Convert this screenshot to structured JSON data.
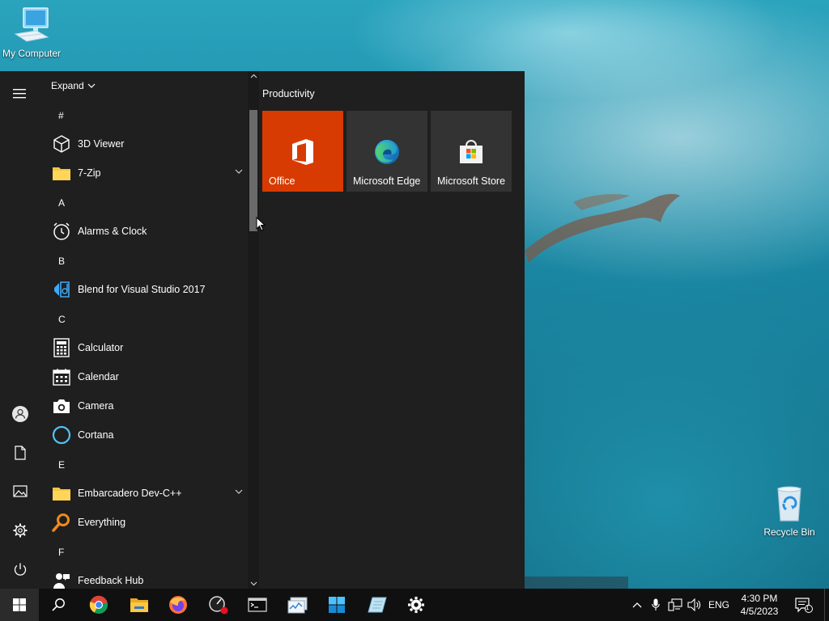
{
  "desktop": {
    "icons": {
      "my_computer": "My Computer",
      "recycle_bin": "Recycle Bin"
    }
  },
  "start_menu": {
    "expand_label": "Expand",
    "headers": {
      "hash": "#",
      "a": "A",
      "b": "B",
      "c": "C",
      "e": "E",
      "f": "F"
    },
    "apps": {
      "viewer3d": "3D Viewer",
      "zip7": "7-Zip",
      "alarms": "Alarms & Clock",
      "blend": "Blend for Visual Studio 2017",
      "calculator": "Calculator",
      "calendar": "Calendar",
      "camera": "Camera",
      "cortana": "Cortana",
      "embarcadero": "Embarcadero Dev-C++",
      "everything": "Everything",
      "feedback": "Feedback Hub"
    },
    "tile_group": "Productivity",
    "tiles": {
      "office": "Office",
      "edge": "Microsoft Edge",
      "store": "Microsoft Store"
    },
    "colors": {
      "office_tile": "#d83b01",
      "tile_bg": "#333333",
      "menu_bg": "#1f1f1f"
    }
  },
  "taskbar": {
    "language": "ENG",
    "time": "4:30 PM",
    "date": "4/5/2023",
    "notification_count": "1"
  }
}
